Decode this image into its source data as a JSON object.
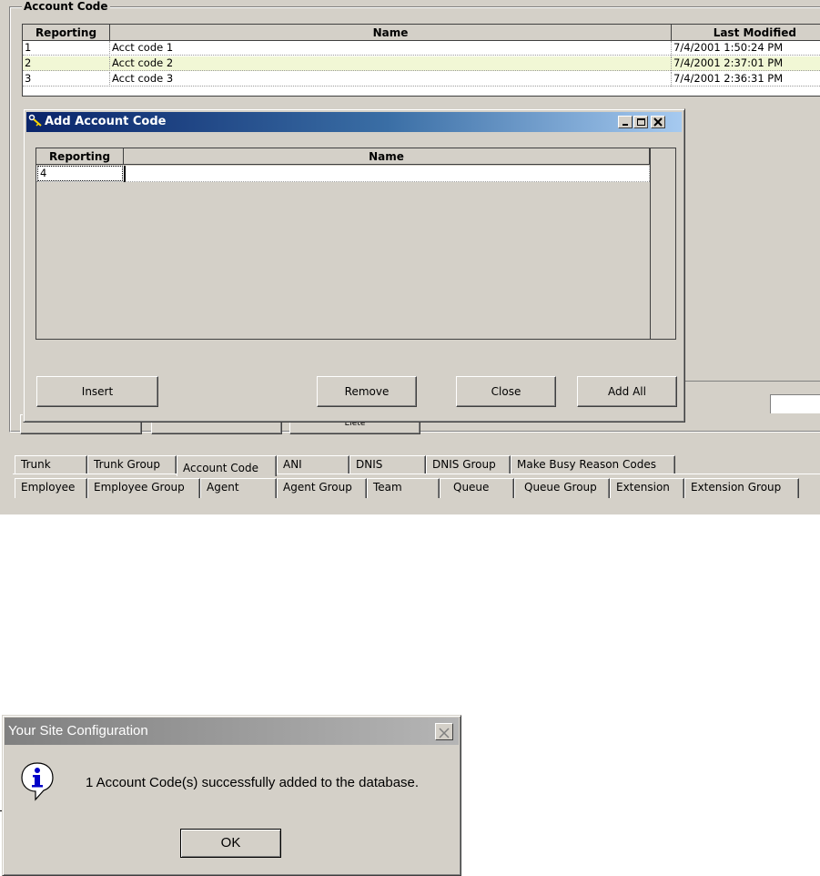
{
  "account_code_group": {
    "title": "Account Code",
    "columns": [
      "Reporting",
      "Name",
      "Last Modified"
    ],
    "rows": [
      {
        "reporting": "1",
        "name": "Acct code 1",
        "modified": "7/4/2001 1:50:24 PM"
      },
      {
        "reporting": "2",
        "name": "Acct code 2",
        "modified": "7/4/2001 2:37:01 PM"
      },
      {
        "reporting": "3",
        "name": "Acct code 3",
        "modified": "7/4/2001 2:36:31 PM"
      }
    ],
    "hidden_button_label": "Elete"
  },
  "add_dialog": {
    "title": "Add Account Code",
    "columns": [
      "Reporting",
      "Name"
    ],
    "rows": [
      {
        "reporting": "4",
        "name": ""
      }
    ],
    "buttons": {
      "insert": "Insert",
      "remove": "Remove",
      "close": "Close",
      "add_all": "Add All"
    }
  },
  "tabs": {
    "row1": [
      "Trunk",
      "Trunk Group",
      "Account Code",
      "ANI",
      "DNIS",
      "DNIS Group",
      "Make Busy Reason Codes"
    ],
    "row2": [
      "Employee",
      "Employee Group",
      "Agent",
      "Agent Group",
      "Team",
      "Queue",
      "Queue Group",
      "Extension",
      "Extension Group"
    ],
    "active": "Account Code"
  },
  "message_box": {
    "title": "Your Site Configuration",
    "message": "1 Account Code(s) successfully added to the database.",
    "ok_label": "OK",
    "icon": "info-icon"
  }
}
